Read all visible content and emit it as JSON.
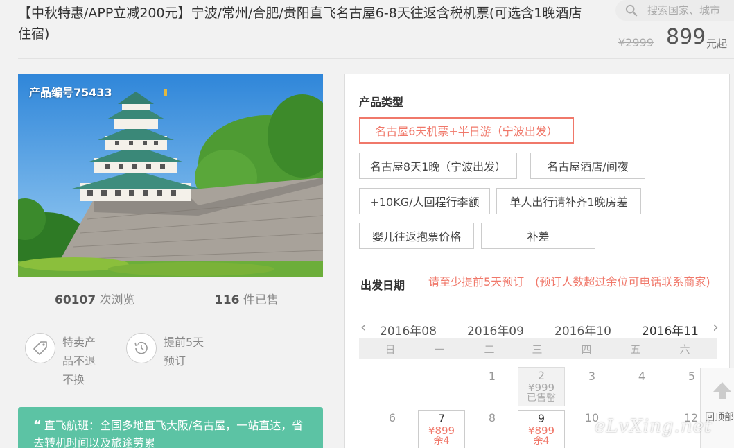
{
  "header": {
    "title": "【中秋特惠/APP立减200元】宁波/常州/合肥/贵阳直飞名古屋6-8天往返含税机票(可选含1晚酒店住宿)",
    "search_placeholder": "搜索国家、城市",
    "price_old": "¥2999",
    "price_now": "899",
    "price_unit": "元起"
  },
  "product": {
    "product_no": "产品编号75433",
    "views_count": "60107",
    "views_label": "次浏览",
    "sold_count": "116",
    "sold_label": "件已售",
    "features": [
      {
        "icon": "tag-icon",
        "text": "特卖产品不退不换"
      },
      {
        "icon": "clock-history-icon",
        "text": "提前5天预订"
      }
    ],
    "highlight": "直飞航班：全国多地直飞大阪/名古屋，一站直达，省去转机时间以及旅途劳累"
  },
  "panel": {
    "type_label": "产品类型",
    "options": [
      {
        "label": "名古屋6天机票+半日游（宁波出发）",
        "selected": true
      },
      {
        "label": "名古屋8天1晚（宁波出发）",
        "selected": false
      },
      {
        "label": "名古屋酒店/间夜",
        "selected": false
      },
      {
        "label": "+10KG/人回程行李额",
        "selected": false
      },
      {
        "label": "单人出行请补齐1晚房差",
        "selected": false
      },
      {
        "label": "婴儿往返抱票价格",
        "selected": false
      },
      {
        "label": "补差",
        "selected": false
      }
    ],
    "date_label": "出发日期",
    "date_note": "请至少提前5天预订　(预订人数超过余位可电话联系商家)",
    "months": [
      "2016年08",
      "2016年09",
      "2016年10",
      "2016年11"
    ],
    "active_month": "2016年11",
    "weekdays": [
      "日",
      "一",
      "二",
      "三",
      "四",
      "五",
      "六"
    ],
    "calendar": {
      "row1": [
        {
          "day": "1"
        },
        {
          "day": "2",
          "price": "¥999",
          "status": "已售罄",
          "soldout": true
        },
        {
          "day": "3"
        },
        {
          "day": "4"
        },
        {
          "day": "5"
        }
      ],
      "row2": [
        {
          "day": "6"
        },
        {
          "day": "7",
          "price": "¥899",
          "status": "余4"
        },
        {
          "day": "8"
        },
        {
          "day": "9",
          "price": "¥899",
          "status": "余4"
        },
        {
          "day": "10"
        },
        {
          "day": "12"
        }
      ]
    }
  },
  "backtop_label": "回顶部",
  "watermark": "eLvXing.net",
  "colors": {
    "accent": "#f0786a",
    "highlight_bg": "#5cc3a4"
  }
}
